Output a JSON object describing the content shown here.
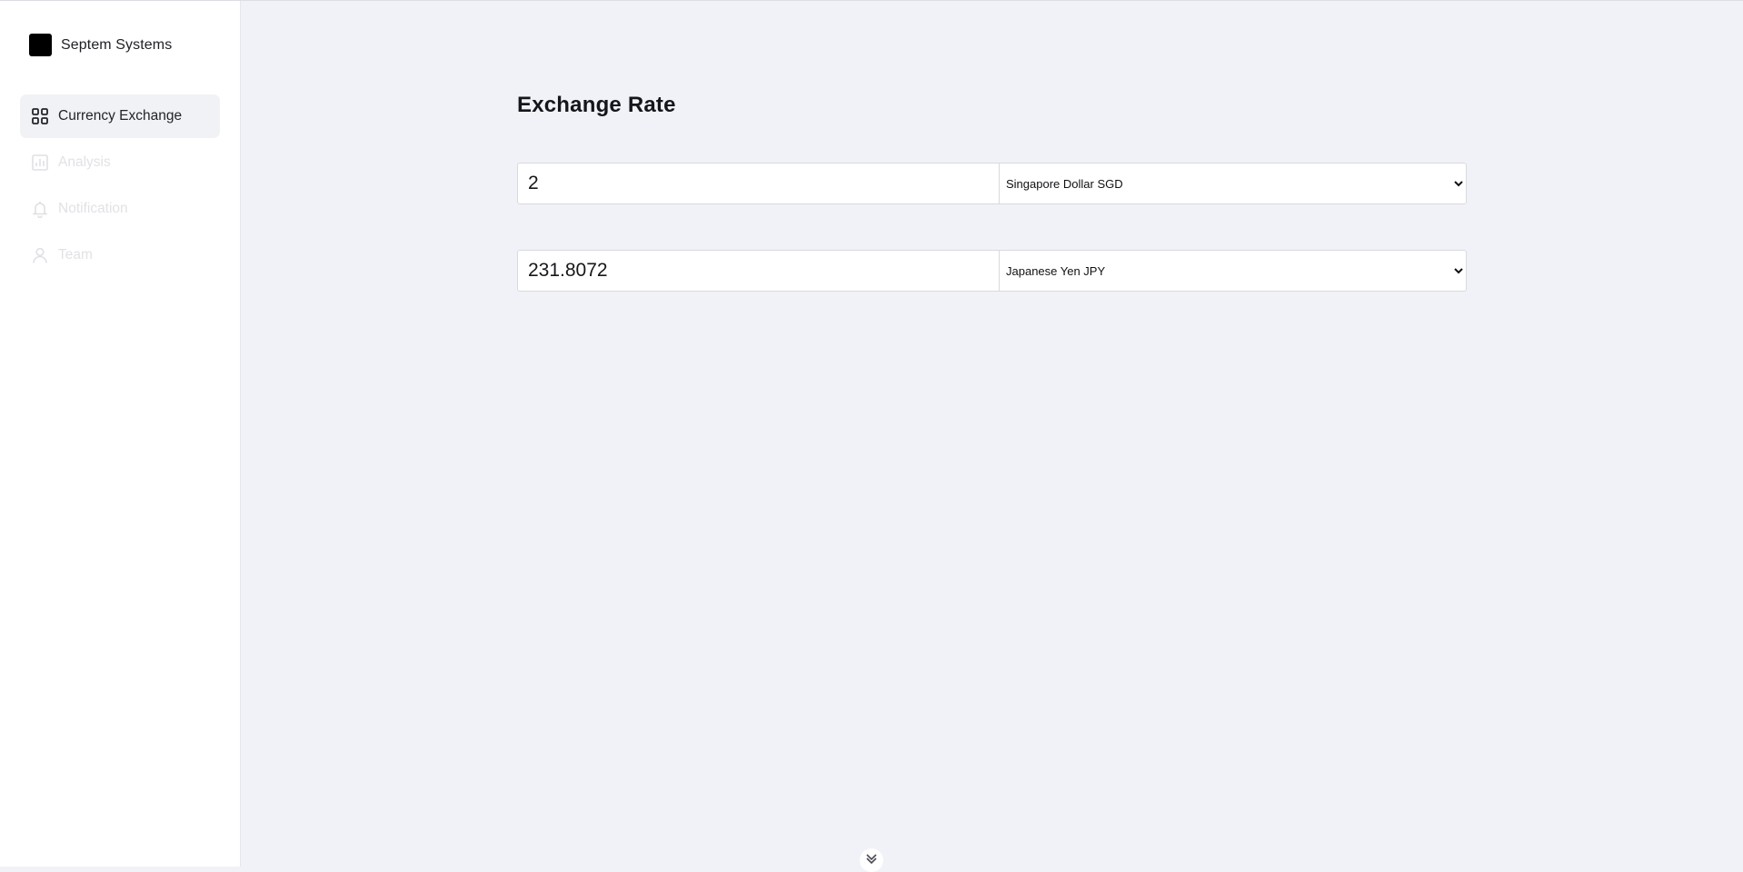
{
  "brand": {
    "name": "Septem Systems",
    "logo_color": "#000000"
  },
  "sidebar": {
    "items": [
      {
        "label": "Currency Exchange",
        "icon": "grid-icon",
        "active": true
      },
      {
        "label": "Analysis",
        "icon": "bar-chart-icon",
        "active": false
      },
      {
        "label": "Notification",
        "icon": "bell-icon",
        "active": false
      },
      {
        "label": "Team",
        "icon": "user-icon",
        "active": false
      }
    ]
  },
  "main": {
    "title": "Exchange Rate",
    "from": {
      "amount": "2",
      "currency": "Singapore Dollar SGD"
    },
    "to": {
      "amount": "231.8072",
      "currency": "Japanese Yen JPY"
    }
  },
  "colors": {
    "background": "#f1f2f7",
    "sidebar_background": "#ffffff",
    "active_item_background": "#f1f2f6",
    "inactive_text": "#e1e2e6"
  },
  "footer": {
    "toggle_icon": "chevron-double-down-icon"
  }
}
